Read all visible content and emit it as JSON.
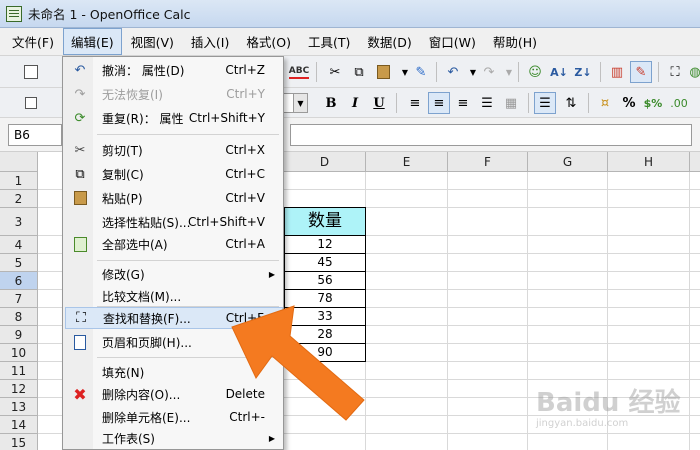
{
  "window": {
    "title": "未命名 1 - OpenOffice Calc"
  },
  "menubar": {
    "items": [
      "文件(F)",
      "编辑(E)",
      "视图(V)",
      "插入(I)",
      "格式(O)",
      "工具(T)",
      "数据(D)",
      "窗口(W)",
      "帮助(H)"
    ],
    "active": "编辑(E)"
  },
  "formula_bar": {
    "cell_ref": "B6",
    "value": ""
  },
  "edit_menu": {
    "items": [
      {
        "label": "撤消： 属性(D)",
        "shortcut": "Ctrl+Z",
        "icon": "undo-icon",
        "disabled": false
      },
      {
        "label": "无法恢复(I)",
        "shortcut": "Ctrl+Y",
        "icon": "redo-icon",
        "disabled": true
      },
      {
        "label": "重复(R)： 属性",
        "shortcut": "Ctrl+Shift+Y",
        "icon": "repeat-icon",
        "disabled": false
      },
      {
        "label": "剪切(T)",
        "shortcut": "Ctrl+X",
        "icon": "scissors-icon",
        "disabled": false
      },
      {
        "label": "复制(C)",
        "shortcut": "Ctrl+C",
        "icon": "copy-icon",
        "disabled": false
      },
      {
        "label": "粘贴(P)",
        "shortcut": "Ctrl+V",
        "icon": "paste-icon",
        "disabled": false
      },
      {
        "label": "选择性粘贴(S)...",
        "shortcut": "Ctrl+Shift+V",
        "icon": "",
        "disabled": false
      },
      {
        "label": "全部选中(A)",
        "shortcut": "Ctrl+A",
        "icon": "select-all-icon",
        "disabled": false
      },
      {
        "label": "修改(G)",
        "shortcut": "",
        "icon": "",
        "disabled": false,
        "submenu": true
      },
      {
        "label": "比较文档(M)...",
        "shortcut": "",
        "icon": "",
        "disabled": false
      },
      {
        "label": "查找和替换(F)...",
        "shortcut": "Ctrl+F",
        "icon": "binoculars-icon",
        "disabled": false,
        "highlighted": true
      },
      {
        "label": "页眉和页脚(H)...",
        "shortcut": "",
        "icon": "header-footer-icon",
        "disabled": false
      },
      {
        "label": "填充(N)",
        "shortcut": "",
        "icon": "",
        "disabled": false
      },
      {
        "label": "删除内容(O)...",
        "shortcut": "Delete",
        "icon": "delete-icon",
        "disabled": false
      },
      {
        "label": "删除单元格(E)...",
        "shortcut": "Ctrl+-",
        "icon": "",
        "disabled": false
      },
      {
        "label": "工作表(S)",
        "shortcut": "",
        "icon": "",
        "disabled": false,
        "submenu": true
      }
    ]
  },
  "sheet": {
    "columns": [
      "D",
      "E",
      "F",
      "G",
      "H"
    ],
    "rows": [
      "1",
      "2",
      "3",
      "4",
      "5",
      "6",
      "7",
      "8",
      "9",
      "10",
      "11",
      "12",
      "13",
      "14",
      "15"
    ],
    "selected_row": "6",
    "d_header": "数量",
    "d_values": [
      "12",
      "45",
      "56",
      "78",
      "33",
      "28",
      "90"
    ]
  },
  "toolbar": {
    "bold": "B",
    "italic": "I",
    "underline": "U",
    "percent": "%",
    "currency": "$",
    "number": "$%"
  },
  "watermark": {
    "main": "Baidu 经验",
    "sub": "jingyan.baidu.com"
  },
  "colors": {
    "accent": "#f47a20",
    "header_fill": "#aef3f8",
    "menu_highlight": "#dbe8f7"
  }
}
